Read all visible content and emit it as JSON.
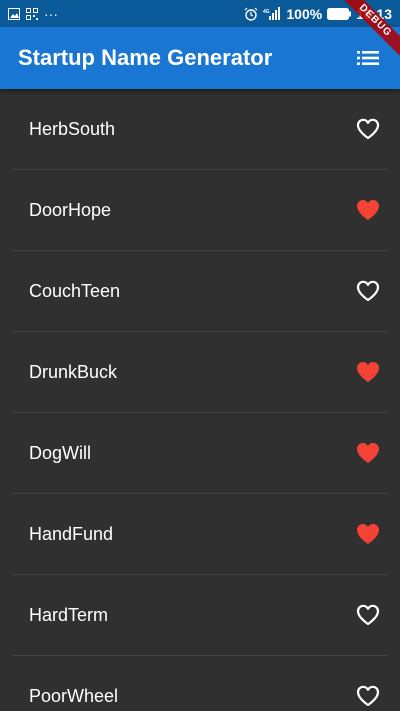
{
  "status_bar": {
    "left_icons": [
      "image-icon",
      "qr-icon",
      "more-dots-icon"
    ],
    "more_text": "···",
    "battery_percent": "100%",
    "time": "18:13",
    "network_label": "4G"
  },
  "app_bar": {
    "title": "Startup Name Generator",
    "action_icon": "list-icon"
  },
  "debug_banner": "DEBUG",
  "colors": {
    "status_bar": "#0a5a99",
    "app_bar": "#1976d2",
    "background": "#303030",
    "favorite": "#f44336",
    "text": "#ffffff"
  },
  "items": [
    {
      "name": "HerbSouth",
      "favorited": false
    },
    {
      "name": "DoorHope",
      "favorited": true
    },
    {
      "name": "CouchTeen",
      "favorited": false
    },
    {
      "name": "DrunkBuck",
      "favorited": true
    },
    {
      "name": "DogWill",
      "favorited": true
    },
    {
      "name": "HandFund",
      "favorited": true
    },
    {
      "name": "HardTerm",
      "favorited": false
    },
    {
      "name": "PoorWheel",
      "favorited": false
    }
  ]
}
